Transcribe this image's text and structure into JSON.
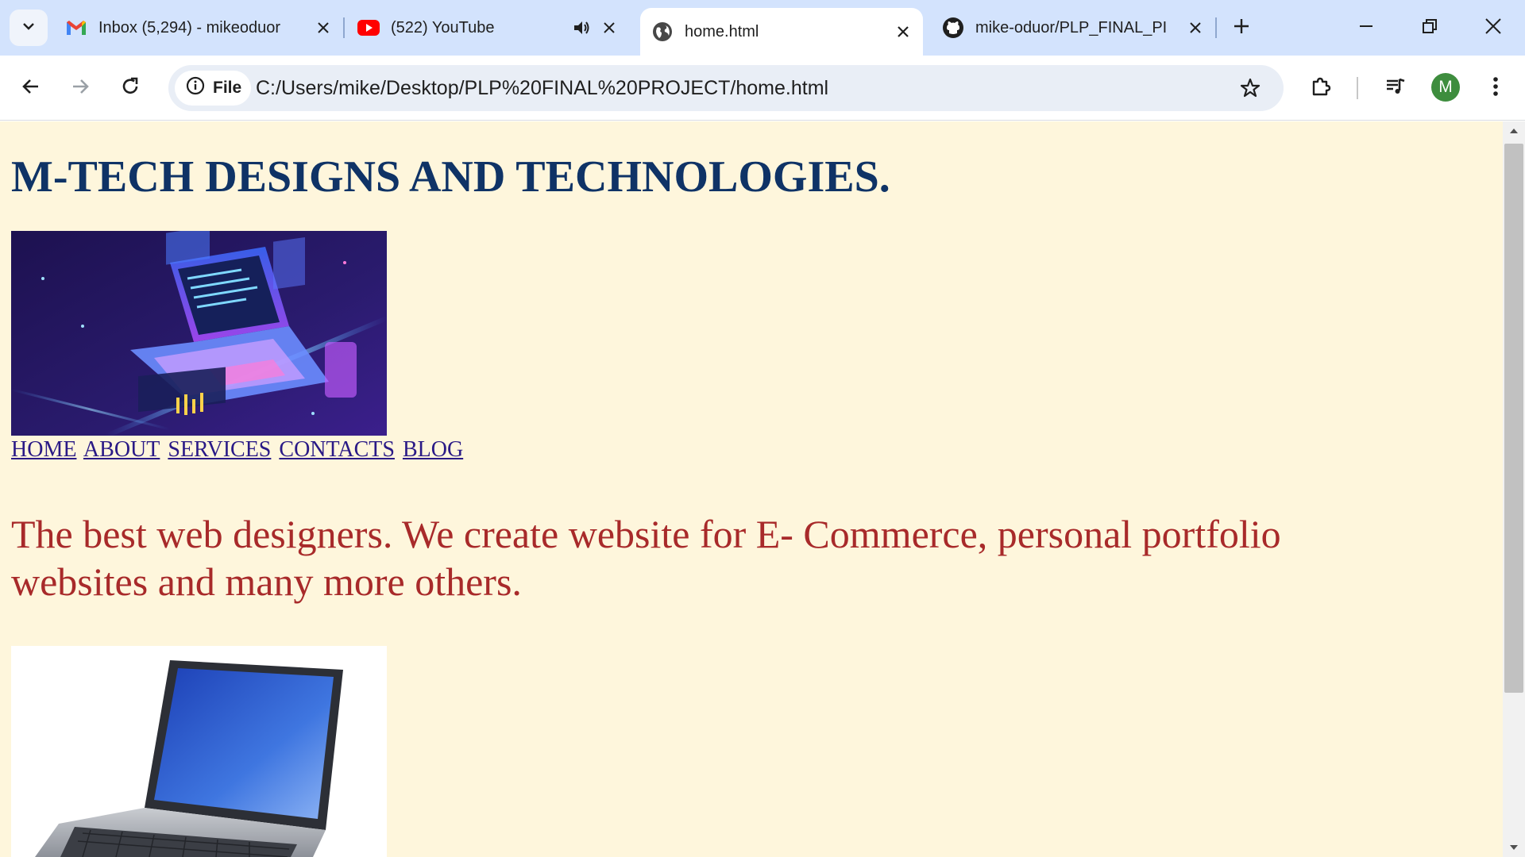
{
  "browser": {
    "tabs": [
      {
        "title": "Inbox (5,294) - mikeoduor",
        "favicon": "gmail-icon"
      },
      {
        "title": "(522) YouTube",
        "favicon": "youtube-icon",
        "audio": true
      },
      {
        "title": "home.html",
        "favicon": "globe-icon",
        "active": true
      },
      {
        "title": "mike-oduor/PLP_FINAL_PI",
        "favicon": "github-icon"
      }
    ],
    "address": {
      "chip_label": "File",
      "url": "C:/Users/mike/Desktop/PLP%20FINAL%20PROJECT/home.html"
    },
    "profile_initial": "M"
  },
  "page": {
    "title": "M-TECH DESIGNS AND TECHNOLOGIES.",
    "nav": [
      "HOME",
      "ABOUT",
      "SERVICES",
      "CONTACTS",
      "BLOG"
    ],
    "tagline": "The best web designers. We create website for E- Commerce, personal portfolio websites and many more others."
  },
  "colors": {
    "page_bg": "#fef6dc",
    "title": "#0f3366",
    "link": "#2a1a86",
    "tagline": "#a82a2a",
    "tabstrip": "#d3e3fd"
  }
}
